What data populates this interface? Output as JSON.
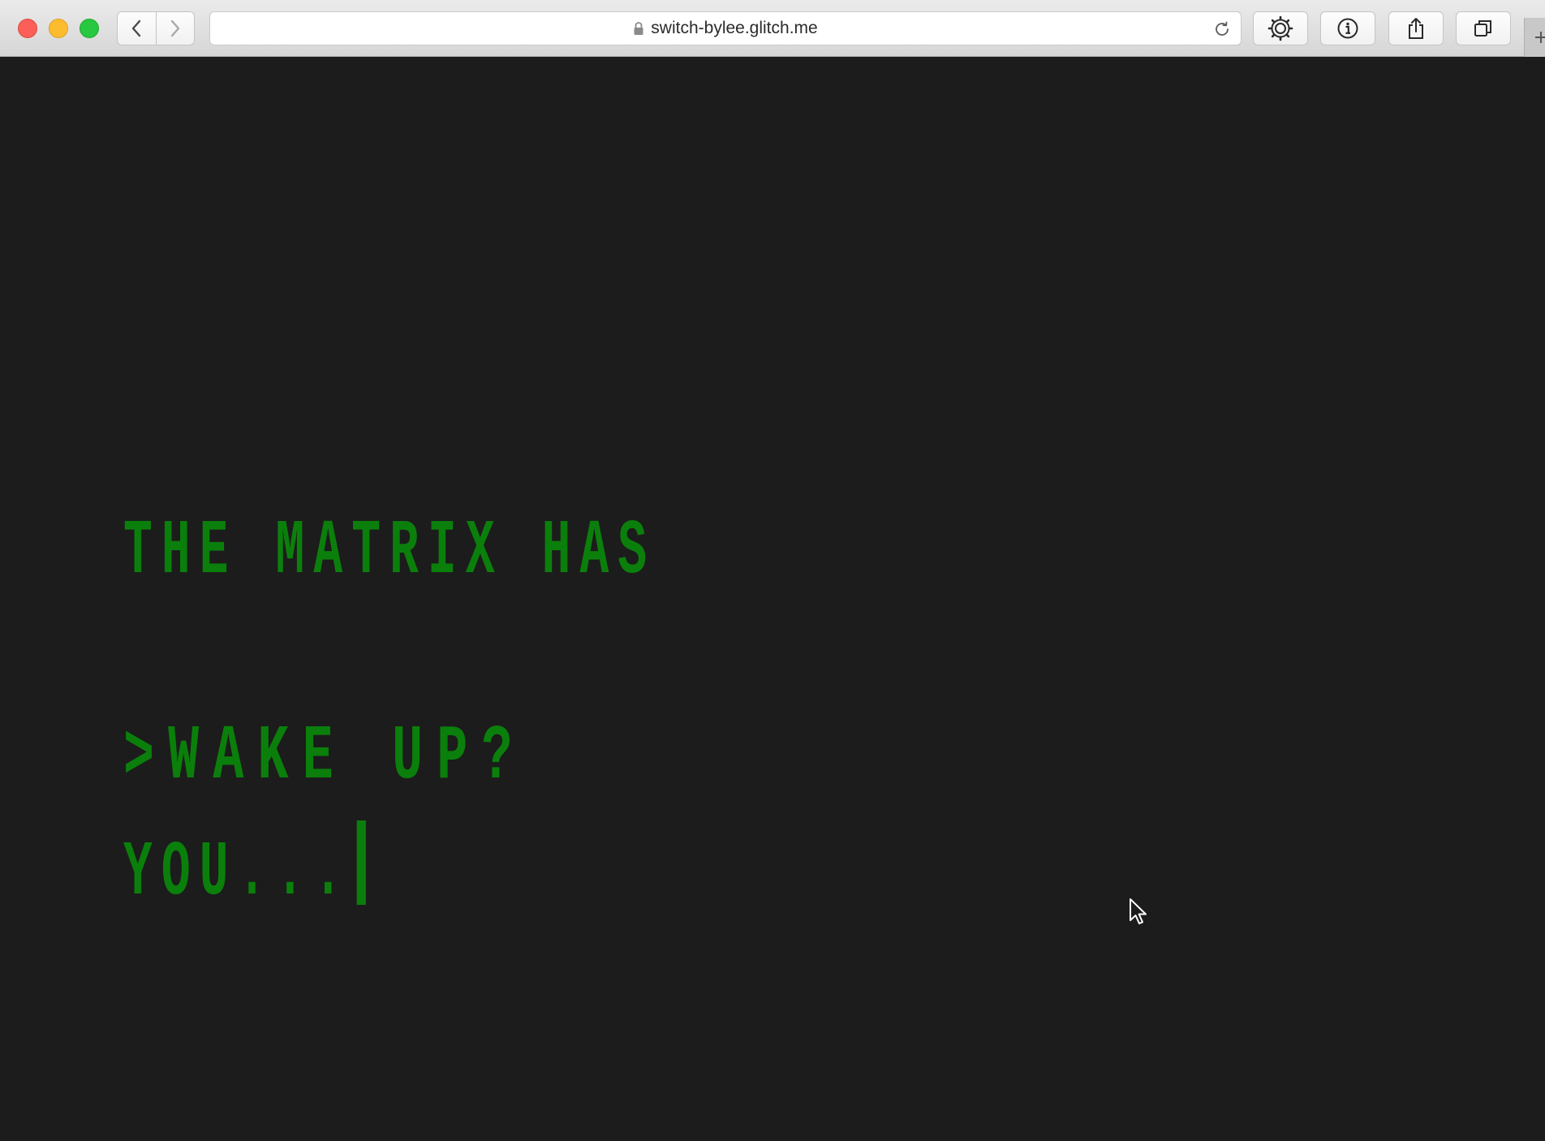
{
  "browser": {
    "url": "switch-bylee.glitch.me",
    "icons": {
      "back": "chevron-left-icon",
      "forward": "chevron-right-icon",
      "lock": "lock-icon",
      "reload": "reload-icon",
      "extension": "gear-icon",
      "info": "info-icon",
      "share": "share-icon",
      "tabs": "tabs-icon",
      "new_tab": "plus-icon"
    }
  },
  "page": {
    "background": "#1c1c1c",
    "text_color": "#0b7f0b",
    "message_line1": "THE MATRIX HAS",
    "message_line2": "YOU...",
    "prompt": ">WAKE UP?"
  }
}
